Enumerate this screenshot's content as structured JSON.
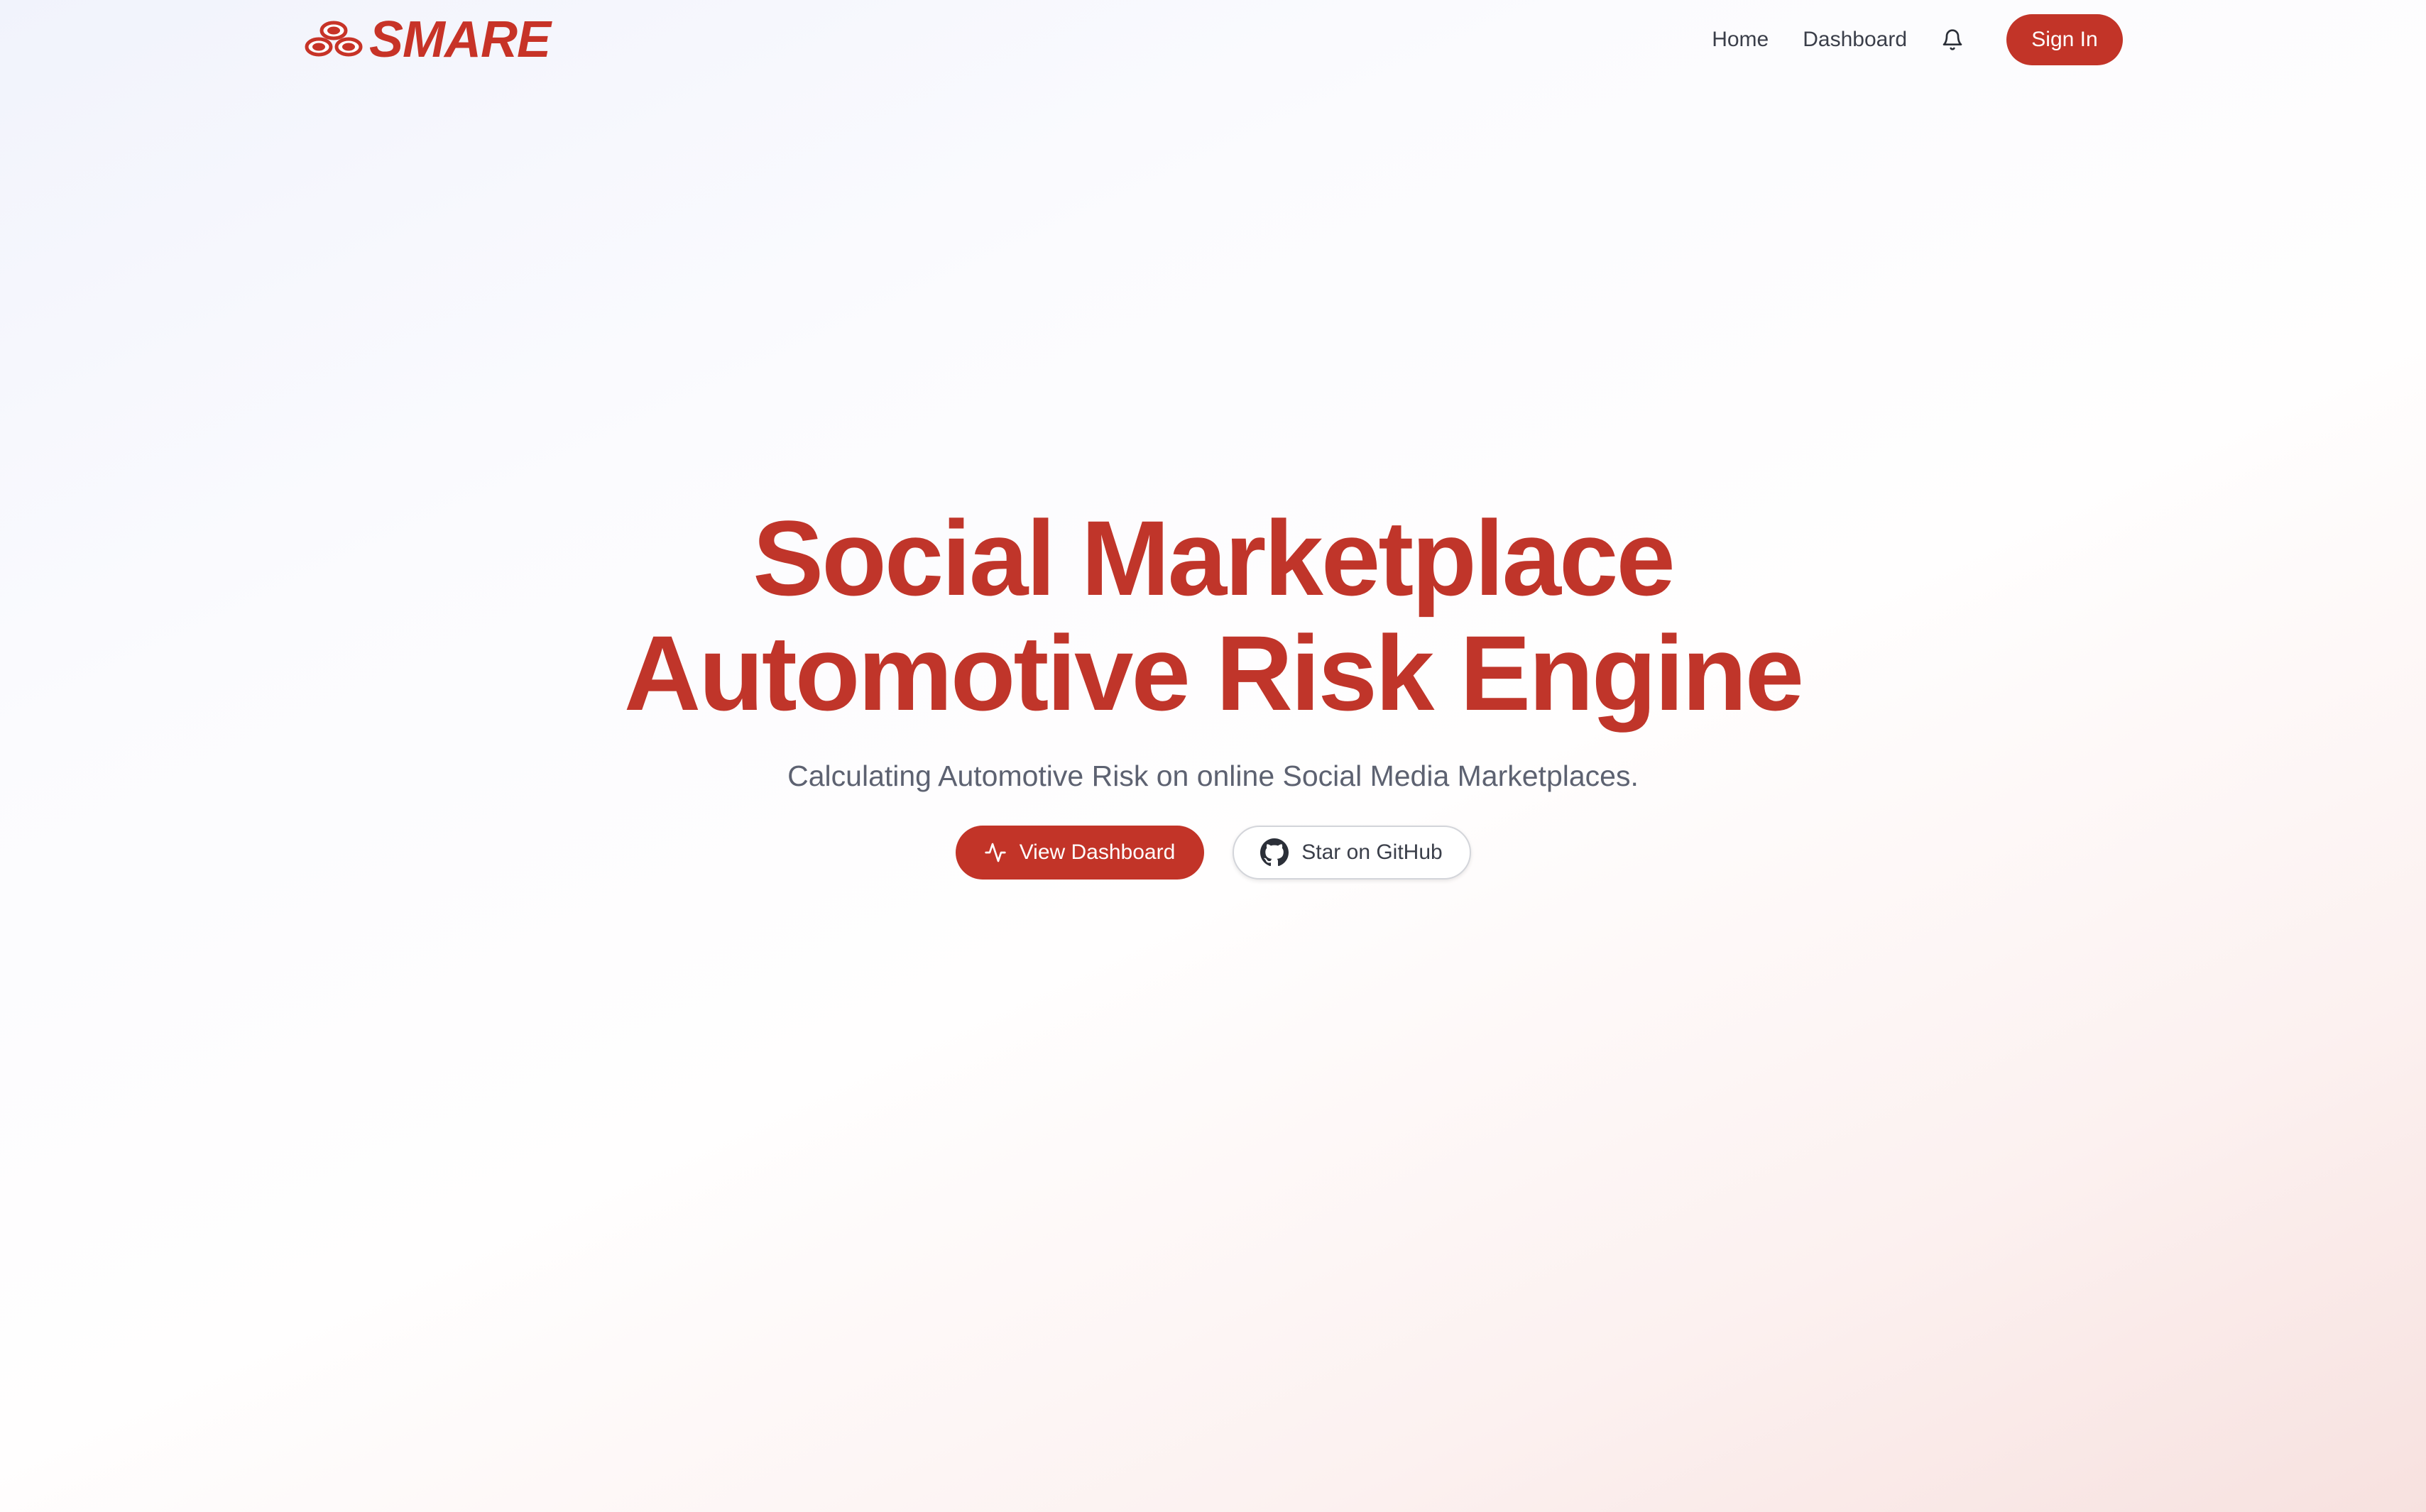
{
  "brand": {
    "name": "SMARE",
    "color": "#c73327"
  },
  "nav": {
    "home": "Home",
    "dashboard": "Dashboard",
    "notification_icon": "bell-icon",
    "sign_in": "Sign In"
  },
  "hero": {
    "title_line1": "Social Marketplace",
    "title_line2": "Automotive Risk Engine",
    "subtitle": "Calculating Automotive Risk on online Social Media Marketplaces.",
    "primary_button": {
      "label": "View Dashboard",
      "icon": "activity-pulse-icon"
    },
    "secondary_button": {
      "label": "Star on GitHub",
      "icon": "github-icon"
    }
  },
  "colors": {
    "accent": "#c23428",
    "title": "#c0352a",
    "subtitle": "#5d6271",
    "nav_text": "#3b3f4a"
  }
}
